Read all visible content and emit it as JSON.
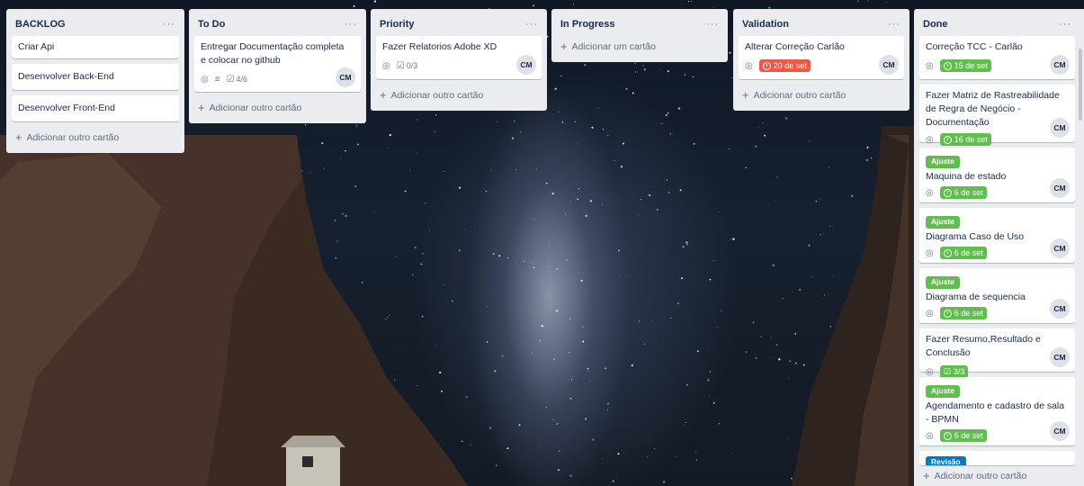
{
  "lists": [
    {
      "title": "BACKLOG",
      "cards": [
        {
          "title": "Criar Api"
        },
        {
          "title": "Desenvolver Back-End"
        },
        {
          "title": "Desenvolver Front-End"
        }
      ],
      "add_label": "Adicionar outro cartão"
    },
    {
      "title": "To Do",
      "cards": [
        {
          "title": "Entregar Documentação completa e colocar no github",
          "checklist": "4/6",
          "avatar": "CM"
        }
      ],
      "add_label": "Adicionar outro cartão"
    },
    {
      "title": "Priority",
      "cards": [
        {
          "title": "Fazer Relatorios Adobe XD",
          "checklist": "0/3",
          "avatar": "CM"
        }
      ],
      "add_label": "Adicionar outro cartão"
    },
    {
      "title": "In Progress",
      "cards": [],
      "add_label": "Adicionar um cartão"
    },
    {
      "title": "Validation",
      "cards": [
        {
          "title": "Alterar Correção Carlão",
          "due": "20 de set",
          "avatar": "CM"
        }
      ],
      "add_label": "Adicionar outro cartão"
    },
    {
      "title": "Done",
      "cards": [
        {
          "title": "Correção TCC - Carlão",
          "due": "15 de set",
          "avatar": "CM"
        },
        {
          "title": "Fazer Matriz de Rastreabilidade de Regra de Negócio - Documentação",
          "due": "16 de set",
          "avatar": "CM"
        },
        {
          "label": "Ajuste",
          "title": "Maquina de estado",
          "due": "6 de set",
          "avatar": "CM"
        },
        {
          "label": "Ajuste",
          "title": "Diagrama Caso de Uso",
          "due": "6 de set",
          "avatar": "CM"
        },
        {
          "label": "Ajuste",
          "title": "Diagrama de sequencia",
          "due": "6 de set",
          "avatar": "CM"
        },
        {
          "title": "Fazer Resumo,Resultado e Conclusão",
          "checklist": "3/3",
          "avatar": "CM"
        },
        {
          "label": "Ajuste",
          "title": "Agendamento e cadastro de sala - BPMN",
          "due": "6 de set",
          "avatar": "CM"
        },
        {
          "label": "Revisão"
        }
      ],
      "add_label": "Adicionar outro cartão"
    }
  ],
  "menu_glyph": "···",
  "add_glyph": "+",
  "icons": {
    "watch": "◎",
    "description": "≡",
    "checklist": "☑"
  },
  "colors": {
    "label_green": "#61bd4f",
    "label_blue": "#0079bf",
    "due_overdue": "#eb5a46",
    "due_complete": "#61bd4f",
    "list_bg": "#ebecf0"
  }
}
